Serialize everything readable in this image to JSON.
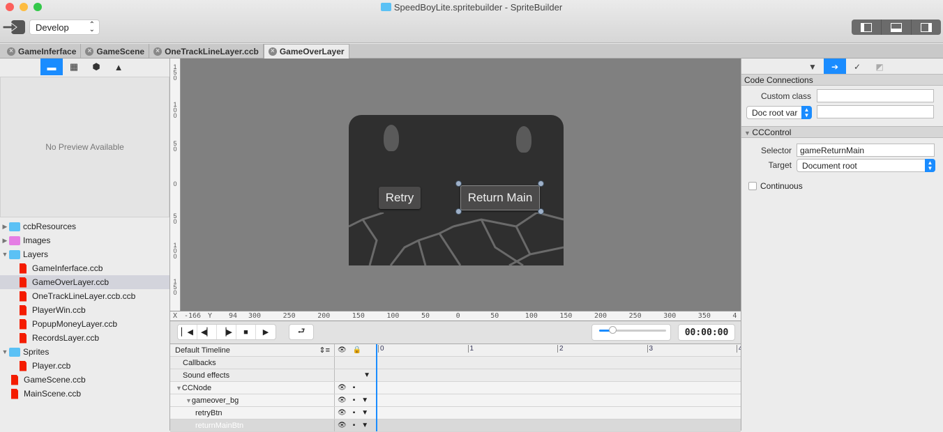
{
  "window": {
    "title": "SpriteBuilder",
    "project": "SpeedBoyLite.spritebuilder",
    "full_title": "SpeedBoyLite.spritebuilder - SpriteBuilder"
  },
  "toolbar": {
    "config_select": "Develop"
  },
  "tabs": [
    {
      "label": "GameInferface"
    },
    {
      "label": "GameScene"
    },
    {
      "label": "OneTrackLineLayer.ccb"
    },
    {
      "label": "GameOverLayer",
      "active": true
    }
  ],
  "left": {
    "preview_text": "No Preview Available",
    "tree": [
      {
        "label": "ccbResources",
        "type": "folder",
        "depth": 0,
        "expand": "collapsed"
      },
      {
        "label": "Images",
        "type": "smart-folder",
        "depth": 0,
        "expand": "collapsed"
      },
      {
        "label": "Layers",
        "type": "folder",
        "depth": 0,
        "expand": "expanded"
      },
      {
        "label": "GameInferface.ccb",
        "type": "ccb",
        "depth": 1
      },
      {
        "label": "GameOverLayer.ccb",
        "type": "ccb",
        "depth": 1,
        "selected": true
      },
      {
        "label": "OneTrackLineLayer.ccb.ccb",
        "type": "ccb",
        "depth": 1
      },
      {
        "label": "PlayerWin.ccb",
        "type": "ccb",
        "depth": 1
      },
      {
        "label": "PopupMoneyLayer.ccb",
        "type": "ccb",
        "depth": 1
      },
      {
        "label": "RecordsLayer.ccb",
        "type": "ccb",
        "depth": 1
      },
      {
        "label": "Sprites",
        "type": "folder",
        "depth": 0,
        "expand": "expanded"
      },
      {
        "label": "Player.ccb",
        "type": "ccb",
        "depth": 1
      },
      {
        "label": "GameScene.ccb",
        "type": "ccb",
        "depth": 0
      },
      {
        "label": "MainScene.ccb",
        "type": "ccb",
        "depth": 0
      }
    ]
  },
  "canvas": {
    "retry_label": "Retry",
    "return_label": "Return Main",
    "vruler": [
      "150",
      "100",
      "50",
      "0",
      "50",
      "100",
      "150"
    ],
    "hruler": [
      "300",
      "250",
      "200",
      "150",
      "100",
      "50",
      "0",
      "50",
      "100",
      "150",
      "200",
      "250",
      "300",
      "350",
      "4"
    ],
    "x_label": "X",
    "x_value": "-166",
    "y_label": "Y",
    "y_value": "94"
  },
  "playback": {
    "timecode": "00:00:00",
    "zoom_percent": 20
  },
  "timeline": {
    "name": "Default Timeline",
    "ticks": [
      "0",
      "1",
      "2",
      "3",
      "4"
    ],
    "rows": [
      {
        "label": "Callbacks",
        "depth": 0
      },
      {
        "label": "Sound effects",
        "depth": 0
      },
      {
        "label": "CCNode",
        "depth": 0,
        "expand": true
      },
      {
        "label": "gameover_bg",
        "depth": 1,
        "expand": true
      },
      {
        "label": "retryBtn",
        "depth": 2
      },
      {
        "label": "returnMainBtn",
        "depth": 2,
        "selected": true
      }
    ]
  },
  "inspector": {
    "code_connections": {
      "title": "Code Connections",
      "custom_class_label": "Custom class",
      "custom_class": "",
      "doc_root_select": "Doc root var",
      "doc_root_value": ""
    },
    "cccontrol": {
      "title": "CCControl",
      "selector_label": "Selector",
      "selector": "gameReturnMain",
      "target_label": "Target",
      "target": "Document root",
      "continuous_label": "Continuous",
      "continuous": false
    }
  },
  "colors": {
    "accent": "#1a8cff",
    "ccb_file": "#f41c00",
    "folder": "#5bc1f5"
  }
}
